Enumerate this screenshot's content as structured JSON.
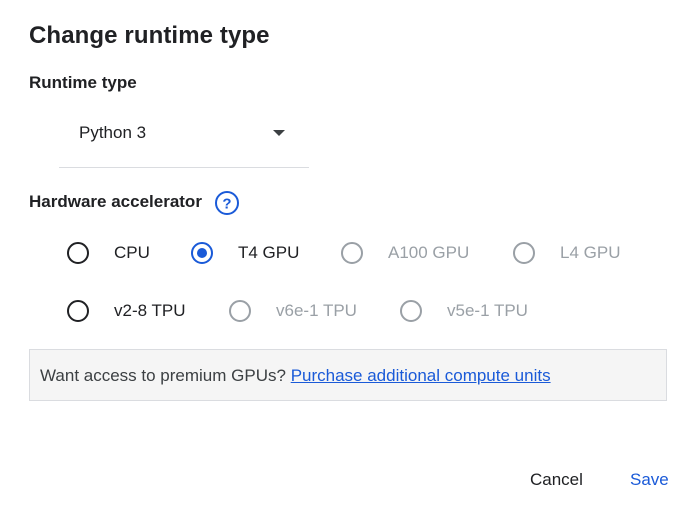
{
  "dialog": {
    "title": "Change runtime type",
    "runtime_type": {
      "label": "Runtime type",
      "selected": "Python 3"
    },
    "hardware": {
      "label": "Hardware accelerator",
      "help_icon": "help-circle-icon",
      "options": [
        {
          "label": "CPU",
          "checked": false,
          "disabled": false
        },
        {
          "label": "T4 GPU",
          "checked": true,
          "disabled": false
        },
        {
          "label": "A100 GPU",
          "checked": false,
          "disabled": true
        },
        {
          "label": "L4 GPU",
          "checked": false,
          "disabled": true
        },
        {
          "label": "v2-8 TPU",
          "checked": false,
          "disabled": false
        },
        {
          "label": "v6e-1 TPU",
          "checked": false,
          "disabled": true
        },
        {
          "label": "v5e-1 TPU",
          "checked": false,
          "disabled": true
        }
      ]
    },
    "promo": {
      "text": "Want access to premium GPUs?",
      "link": "Purchase additional compute units"
    },
    "buttons": {
      "cancel": "Cancel",
      "save": "Save"
    }
  },
  "colors": {
    "accent": "#1a5ad8",
    "disabled": "#9aa0a6",
    "promo_bg": "#f5f5f5"
  }
}
